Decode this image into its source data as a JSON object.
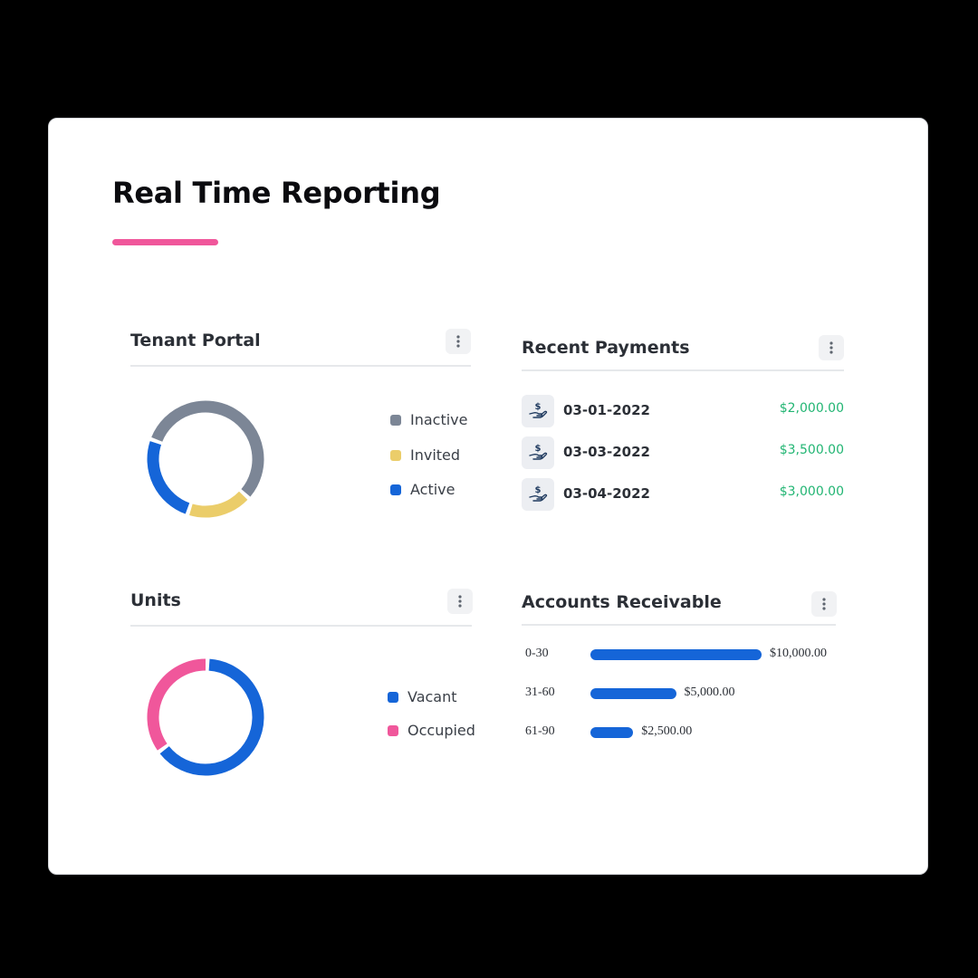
{
  "header": {
    "title": "Real Time Reporting"
  },
  "colors": {
    "accent": "#f0579b",
    "inactive": "#7c8696",
    "invited": "#ebcd6a",
    "active": "#1565d8",
    "vacant": "#1565d8",
    "occupied": "#f0579b",
    "amount": "#22b573"
  },
  "tenant_portal": {
    "title": "Tenant Portal",
    "menu_icon": "more-vertical-icon",
    "legend": [
      {
        "label": "Inactive",
        "color": "#7c8696"
      },
      {
        "label": "Invited",
        "color": "#ebcd6a"
      },
      {
        "label": "Active",
        "color": "#1565d8"
      }
    ],
    "chart_data": {
      "type": "pie",
      "variant": "donut",
      "labels": [
        "Inactive",
        "Invited",
        "Active"
      ],
      "values": [
        55,
        18,
        25
      ],
      "colors": [
        "#7c8696",
        "#ebcd6a",
        "#1565d8"
      ]
    }
  },
  "recent_payments": {
    "title": "Recent Payments",
    "menu_icon": "more-vertical-icon",
    "row_icon": "hand-dollar-icon",
    "rows": [
      {
        "date": "03-01-2022",
        "amount": "$2,000.00"
      },
      {
        "date": "03-03-2022",
        "amount": "$3,500.00"
      },
      {
        "date": "03-04-2022",
        "amount": "$3,000.00"
      }
    ]
  },
  "units": {
    "title": "Units",
    "menu_icon": "more-vertical-icon",
    "legend": [
      {
        "label": "Vacant",
        "color": "#1565d8"
      },
      {
        "label": "Occupied",
        "color": "#f0579b"
      }
    ],
    "chart_data": {
      "type": "pie",
      "variant": "donut",
      "labels": [
        "Vacant",
        "Occupied"
      ],
      "values": [
        63,
        35
      ],
      "colors": [
        "#1565d8",
        "#f0579b"
      ]
    }
  },
  "accounts_receivable": {
    "title": "Accounts Receivable",
    "menu_icon": "more-vertical-icon",
    "rows": [
      {
        "label": "0-30",
        "amount": "$10,000.00"
      },
      {
        "label": "31-60",
        "amount": "$5,000.00"
      },
      {
        "label": "61-90",
        "amount": "$2,500.00"
      }
    ],
    "chart_data": {
      "type": "bar",
      "orientation": "horizontal",
      "categories": [
        "0-30",
        "31-60",
        "61-90"
      ],
      "values": [
        10000,
        5000,
        2500
      ],
      "color": "#1565d8"
    }
  }
}
